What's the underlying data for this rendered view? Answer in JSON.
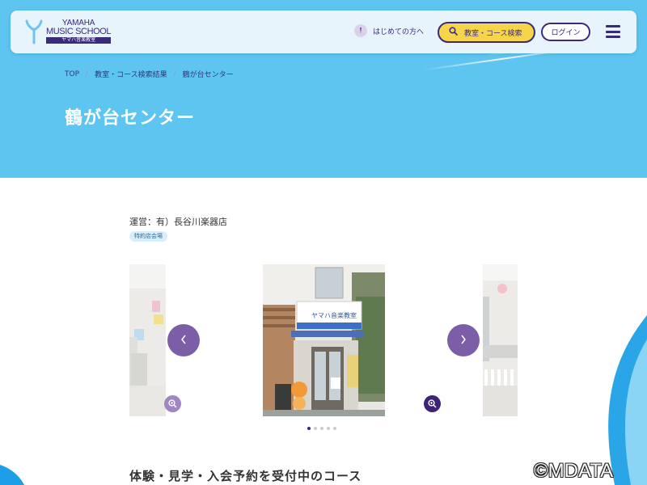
{
  "header": {
    "logo": {
      "line1": "YAMAHA",
      "line2": "MUSIC SCHOOL",
      "line3": "ヤマハ音楽教室"
    },
    "first_time_label": "はじめての方へ",
    "search_label": "教室・コース検索",
    "login_label": "ログイン"
  },
  "breadcrumb": {
    "items": [
      "TOP",
      "教室・コース検索結果",
      "鶴が台センター"
    ]
  },
  "page": {
    "title": "鶴が台センター",
    "operator": "運営：有）長谷川楽器店",
    "badge": "特約店会場"
  },
  "storefront_sign": "ヤマハ音楽教室",
  "carousel": {
    "dots_total": 5,
    "active_index": 0
  },
  "course_heading": "体験・見学・入会予約を受付中のコース",
  "watermark": "©MDATA",
  "colors": {
    "brand_purple": "#3a2a7a",
    "hero_blue": "#5ec4f0",
    "search_yellow": "#f7d54a",
    "arrow_purple": "#7c5ea8"
  },
  "icons": {
    "search": "search-icon",
    "menu": "menu-icon",
    "prev": "chevron-left-icon",
    "next": "chevron-right-icon",
    "zoom": "zoom-in-icon"
  }
}
